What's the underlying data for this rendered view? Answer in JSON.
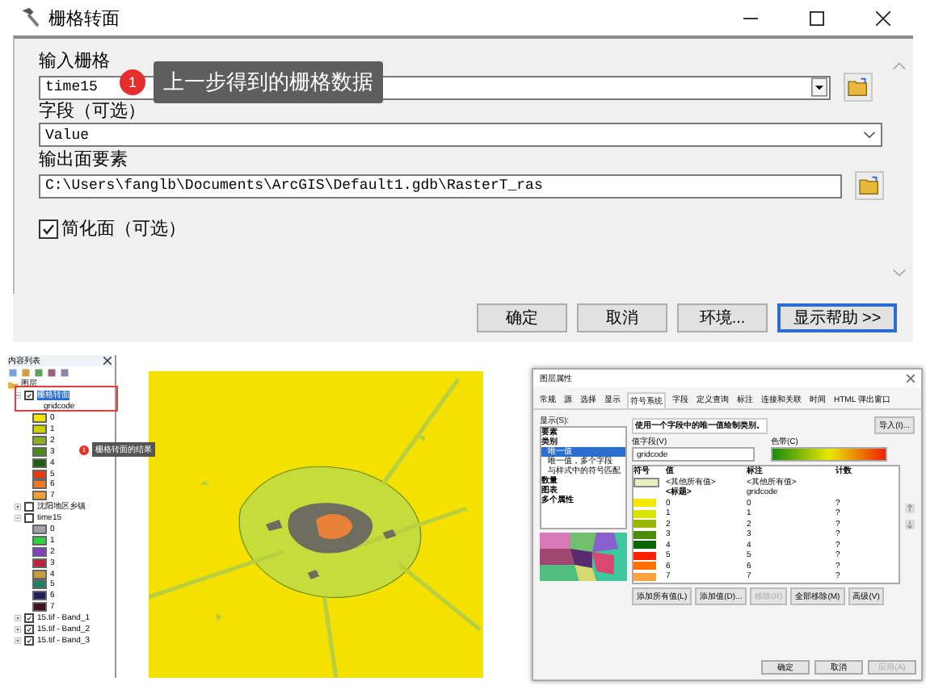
{
  "tool_dialog": {
    "title": "栅格转面",
    "input_raster": {
      "label": "输入栅格",
      "value": "time15"
    },
    "callout": {
      "number": "1",
      "text": "上一步得到的栅格数据"
    },
    "field": {
      "label": "字段（可选）",
      "value": "Value"
    },
    "output": {
      "label": "输出面要素",
      "value": "C:\\Users\\fanglb\\Documents\\ArcGIS\\Default1.gdb\\RasterT_ras"
    },
    "simplify": {
      "label": "简化面（可选）",
      "checked": true
    },
    "buttons": [
      {
        "label": "确定",
        "selected": false
      },
      {
        "label": "取消",
        "selected": false
      },
      {
        "label": "环境...",
        "selected": false
      },
      {
        "label": "显示帮助 >>",
        "selected": true
      }
    ]
  },
  "toc": {
    "title": "内容列表",
    "root": "图层",
    "layers": [
      {
        "name": "栅格转面",
        "checked": true,
        "selected": true,
        "expanded": true,
        "field": "gridcode",
        "classes": [
          {
            "label": "0",
            "color": "#f5e400"
          },
          {
            "label": "1",
            "color": "#c8d400"
          },
          {
            "label": "2",
            "color": "#8bb020"
          },
          {
            "label": "3",
            "color": "#4d8a1c"
          },
          {
            "label": "4",
            "color": "#1e5e14"
          },
          {
            "label": "5",
            "color": "#e83a10"
          },
          {
            "label": "6",
            "color": "#f07820"
          },
          {
            "label": "7",
            "color": "#f0a030"
          }
        ]
      },
      {
        "name": "沈阳地区乡镇",
        "checked": false,
        "selected": false,
        "expanded": false
      },
      {
        "name": "time15",
        "checked": false,
        "selected": false,
        "expanded": true,
        "classes": [
          {
            "label": "0",
            "color": "#a0a0a8"
          },
          {
            "label": "1",
            "color": "#30d040"
          },
          {
            "label": "2",
            "color": "#8040c0"
          },
          {
            "label": "3",
            "color": "#c02040"
          },
          {
            "label": "4",
            "color": "#c8a040"
          },
          {
            "label": "5",
            "color": "#208060"
          },
          {
            "label": "6",
            "color": "#202060"
          },
          {
            "label": "7",
            "color": "#401020"
          }
        ]
      },
      {
        "name": "15.tif - Band_1",
        "checked": true,
        "selected": false,
        "expanded": false
      },
      {
        "name": "15.tif - Band_2",
        "checked": true,
        "selected": false,
        "expanded": false
      },
      {
        "name": "15.tif - Band_3",
        "checked": true,
        "selected": false,
        "expanded": false
      }
    ],
    "callout": {
      "number": "1",
      "text": "栅格转面的结果"
    }
  },
  "layer_properties": {
    "title": "图层属性",
    "tabs": [
      {
        "label": "常规",
        "selected": false
      },
      {
        "label": "源",
        "selected": false
      },
      {
        "label": "选择",
        "selected": false
      },
      {
        "label": "显示",
        "selected": false
      },
      {
        "label": "符号系统",
        "selected": true
      },
      {
        "label": "字段",
        "selected": false
      },
      {
        "label": "定义查询",
        "selected": false
      },
      {
        "label": "标注",
        "selected": false
      },
      {
        "label": "连接和关联",
        "selected": false
      },
      {
        "label": "时间",
        "selected": false
      },
      {
        "label": "HTML 弹出窗口",
        "selected": false
      }
    ],
    "show_label": "显示(S):",
    "show_list": [
      {
        "label": "要素",
        "selected": false
      },
      {
        "label": "类别",
        "selected": false,
        "children": [
          {
            "label": "唯一值",
            "selected": true
          },
          {
            "label": "唯一值，多个字段",
            "selected": false
          },
          {
            "label": "与样式中的符号匹配",
            "selected": false
          }
        ]
      },
      {
        "label": "数量",
        "selected": false
      },
      {
        "label": "图表",
        "selected": false
      },
      {
        "label": "多个属性",
        "selected": false
      }
    ],
    "description": "使用一个字段中的唯一值绘制类别。",
    "import_button": "导入(I)...",
    "value_field": {
      "label": "值字段(V)",
      "value": "gridcode"
    },
    "color_ramp": {
      "label": "色带(C)"
    },
    "columns": [
      "符号",
      "值",
      "标注",
      "计数"
    ],
    "rows": [
      {
        "kind": "other",
        "value": "<其他所有值>",
        "label": "<其他所有值>"
      },
      {
        "kind": "heading",
        "value": "<标题>",
        "label": "gridcode"
      },
      {
        "kind": "class",
        "color": "#f8e800",
        "value": "0",
        "label": "0",
        "count": "?"
      },
      {
        "kind": "class",
        "color": "#d8e400",
        "value": "1",
        "label": "1",
        "count": "?"
      },
      {
        "kind": "class",
        "color": "#98b800",
        "value": "2",
        "label": "2",
        "count": "?"
      },
      {
        "kind": "class",
        "color": "#4c8c00",
        "value": "3",
        "label": "3",
        "count": "?"
      },
      {
        "kind": "class",
        "color": "#0a6400",
        "value": "4",
        "label": "4",
        "count": "?"
      },
      {
        "kind": "class",
        "color": "#ff2000",
        "value": "5",
        "label": "5",
        "count": "?"
      },
      {
        "kind": "class",
        "color": "#ff7000",
        "value": "6",
        "label": "6",
        "count": "?"
      },
      {
        "kind": "class",
        "color": "#ffa040",
        "value": "7",
        "label": "7",
        "count": "?"
      }
    ],
    "action_buttons": [
      {
        "label": "添加所有值(L)",
        "disabled": false
      },
      {
        "label": "添加值(D)...",
        "disabled": false
      },
      {
        "label": "移除(R)",
        "disabled": true
      },
      {
        "label": "全部移除(M)",
        "disabled": false
      },
      {
        "label": "高级(V)",
        "disabled": false
      }
    ],
    "footer_buttons": [
      {
        "label": "确定",
        "disabled": false
      },
      {
        "label": "取消",
        "disabled": false
      },
      {
        "label": "应用(A)",
        "disabled": true
      }
    ]
  }
}
